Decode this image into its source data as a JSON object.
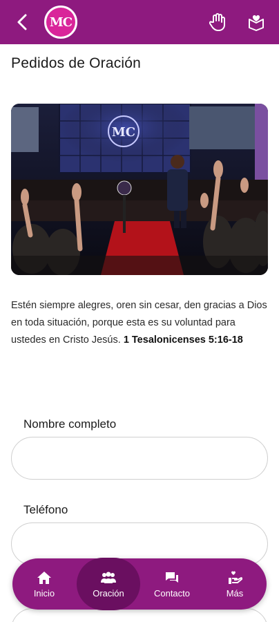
{
  "appbar": {
    "back_icon": "chevron-left-icon",
    "logo_text": "MC",
    "actions": [
      {
        "icon": "raised-hand-icon"
      },
      {
        "icon": "book-heart-icon"
      }
    ],
    "color": "#8e1a7f"
  },
  "page": {
    "title": "Pedidos de Oración"
  },
  "hero": {
    "icon": "worship-stage-photo"
  },
  "verse": {
    "text": "Estén siempre alegres, oren sin cesar, den gracias a Dios en toda situación, porque esta es su voluntad para ustedes en Cristo Jesús.",
    "reference": "1 Tesalonicenses 5:16-18"
  },
  "form": {
    "full_name_label": "Nombre completo",
    "full_name_value": "",
    "phone_label": "Teléfono",
    "phone_value": ""
  },
  "bottom_nav": {
    "active": "Oración",
    "items": [
      {
        "label": "Inicio",
        "icon": "home-icon"
      },
      {
        "label": "Oración",
        "icon": "group-icon"
      },
      {
        "label": "Contacto",
        "icon": "chat-icon"
      },
      {
        "label": "Más",
        "icon": "hand-heart-icon"
      }
    ]
  }
}
